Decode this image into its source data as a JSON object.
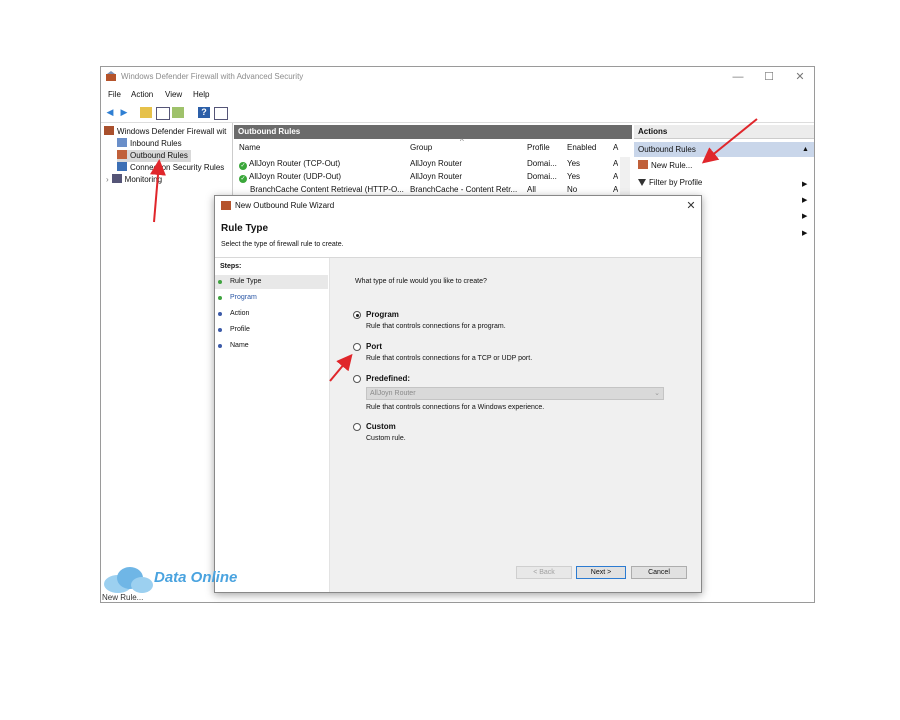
{
  "window": {
    "title": "Windows Defender Firewall with Advanced Security",
    "controls": {
      "minimize": "—",
      "maximize": "☐",
      "close": "✕"
    }
  },
  "menubar": [
    "File",
    "Action",
    "View",
    "Help"
  ],
  "tree": {
    "root": "Windows Defender Firewall wit",
    "items": [
      "Inbound Rules",
      "Outbound Rules",
      "Connection Security Rules",
      "Monitoring"
    ],
    "selected": "Outbound Rules"
  },
  "outbound": {
    "header": "Outbound Rules",
    "columns": [
      "Name",
      "Group",
      "Profile",
      "Enabled",
      "A"
    ],
    "rows": [
      {
        "name": "AllJoyn Router (TCP-Out)",
        "group": "AllJoyn Router",
        "profile": "Domai...",
        "enabled": "Yes",
        "a": "A",
        "check": true
      },
      {
        "name": "AllJoyn Router (UDP-Out)",
        "group": "AllJoyn Router",
        "profile": "Domai...",
        "enabled": "Yes",
        "a": "A",
        "check": true
      },
      {
        "name": "BranchCache Content Retrieval (HTTP-O...",
        "group": "BranchCache - Content Retr...",
        "profile": "All",
        "enabled": "No",
        "a": "A",
        "check": false
      }
    ]
  },
  "actions": {
    "header": "Actions",
    "section": "Outbound Rules",
    "items": [
      "New Rule...",
      "Filter by Profile"
    ]
  },
  "status_text": "New Rule...",
  "wizard": {
    "title": "New Outbound Rule Wizard",
    "heading": "Rule Type",
    "subtitle": "Select the type of firewall rule to create.",
    "steps_label": "Steps:",
    "steps": [
      "Rule Type",
      "Program",
      "Action",
      "Profile",
      "Name"
    ],
    "question": "What type of rule would you like to create?",
    "options": [
      {
        "label": "Program",
        "desc": "Rule that controls connections for a program.",
        "selected": true
      },
      {
        "label": "Port",
        "desc": "Rule that controls connections for a TCP or UDP port.",
        "selected": false
      },
      {
        "label": "Predefined:",
        "desc": "Rule that controls connections for a Windows experience.",
        "selected": false
      },
      {
        "label": "Custom",
        "desc": "Custom rule.",
        "selected": false
      }
    ],
    "predefined_value": "AllJoyn Router",
    "buttons": {
      "back": "< Back",
      "next": "Next >",
      "cancel": "Cancel"
    }
  },
  "watermark": "Data Online",
  "colors": {
    "annotation": "#e0262b",
    "step_done": "#3fa33f",
    "step_pending": "#3c5aa8",
    "selection": "#c9d6ea"
  }
}
